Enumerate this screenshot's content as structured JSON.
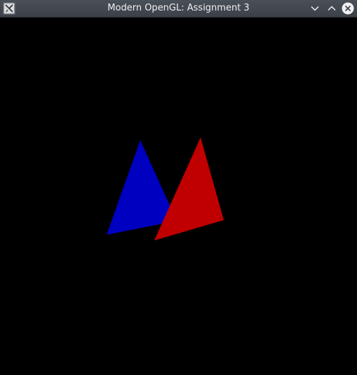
{
  "window": {
    "title": "Modern OpenGL: Assignment 3",
    "icons": {
      "app": "app-icon",
      "minimize": "chevron-down-icon",
      "maximize": "chevron-up-icon",
      "close": "close-icon"
    }
  },
  "scene": {
    "background_color": "#000000",
    "triangles": [
      {
        "name": "blue-triangle",
        "color": "#0000c0"
      },
      {
        "name": "red-triangle",
        "color": "#c00000"
      }
    ]
  }
}
